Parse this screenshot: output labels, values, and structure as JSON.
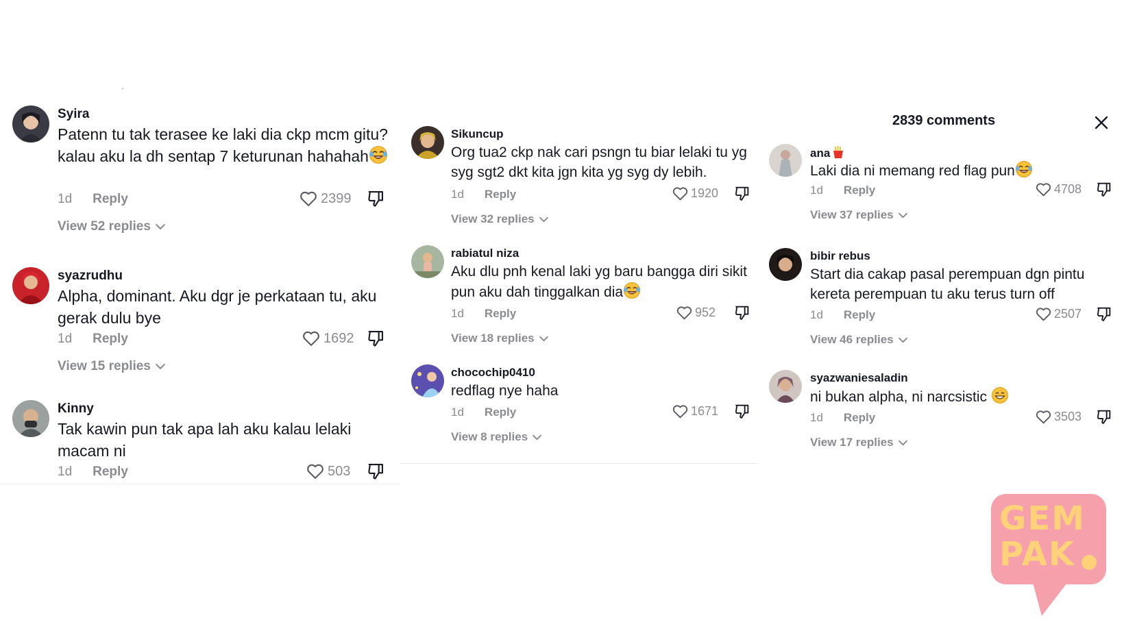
{
  "panel": {
    "comments_count": "2839 comments",
    "close_icon": "close-icon"
  },
  "icons": {
    "like": "heart-outline-icon",
    "dislike": "thumbs-down-outline-icon",
    "view_chevron": "chevron-down-icon"
  },
  "colors": {
    "text": "#161823",
    "muted": "#8a8b91",
    "logo_pink": "#f5a0aa",
    "logo_yellow": "#ffd27a"
  },
  "left": {
    "comments": [
      {
        "username": "Syira",
        "text": "Patenn tu tak terasee ke laki dia ckp mcm gitu? kalau aku la dh sentap 7 keturunan hahahah",
        "emoji": "laughing-tears-emoji",
        "time": "1d",
        "reply": "Reply",
        "likes": "2399",
        "view_replies": "View 52 replies"
      },
      {
        "username": "syazrudhu",
        "text": "Alpha, dominant. Aku dgr je perkataan tu, aku gerak dulu bye",
        "time": "1d",
        "reply": "Reply",
        "likes": "1692",
        "view_replies": "View 15 replies"
      },
      {
        "username": "Kinny",
        "text": "Tak kawin pun tak apa lah aku kalau lelaki macam ni",
        "time": "1d",
        "reply": "Reply",
        "likes": "503"
      }
    ]
  },
  "mid": {
    "comments": [
      {
        "username": "Sikuncup",
        "text": "Org tua2 ckp nak cari psngn tu biar lelaki tu yg syg sgt2 dkt kita jgn kita yg syg dy lebih.",
        "time": "1d",
        "reply": "Reply",
        "likes": "1920",
        "view_replies": "View 32 replies"
      },
      {
        "username": "rabiatul niza",
        "text": "Aku dlu pnh kenal laki yg baru bangga diri sikit pun aku dah tinggalkan dia",
        "emoji": "laughing-tears-emoji",
        "time": "1d",
        "reply": "Reply",
        "likes": "952",
        "view_replies": "View 18 replies"
      },
      {
        "username": "chocochip0410",
        "text": "redflag nye haha",
        "time": "1d",
        "reply": "Reply",
        "likes": "1671",
        "view_replies": "View 8 replies"
      }
    ]
  },
  "right": {
    "comments": [
      {
        "username": "ana",
        "username_emoji": "fries-emoji",
        "text": "Laki dia ni memang red flag pun",
        "emoji": "laughing-tears-emoji",
        "time": "1d",
        "reply": "Reply",
        "likes": "4708",
        "view_replies": "View 37 replies"
      },
      {
        "username": "bibir rebus",
        "text": "Start dia cakap pasal perempuan dgn pintu kereta perempuan tu aku terus turn off",
        "time": "1d",
        "reply": "Reply",
        "likes": "2507",
        "view_replies": "View 46 replies"
      },
      {
        "username": "syazwaniesaladin",
        "text": "ni bukan alpha, ni narcsistic ",
        "emoji": "grinning-emoji",
        "time": "1d",
        "reply": "Reply",
        "likes": "3503",
        "view_replies": "View 17 replies"
      }
    ]
  },
  "logo": {
    "line1": "GEM",
    "line2": "PAK"
  }
}
